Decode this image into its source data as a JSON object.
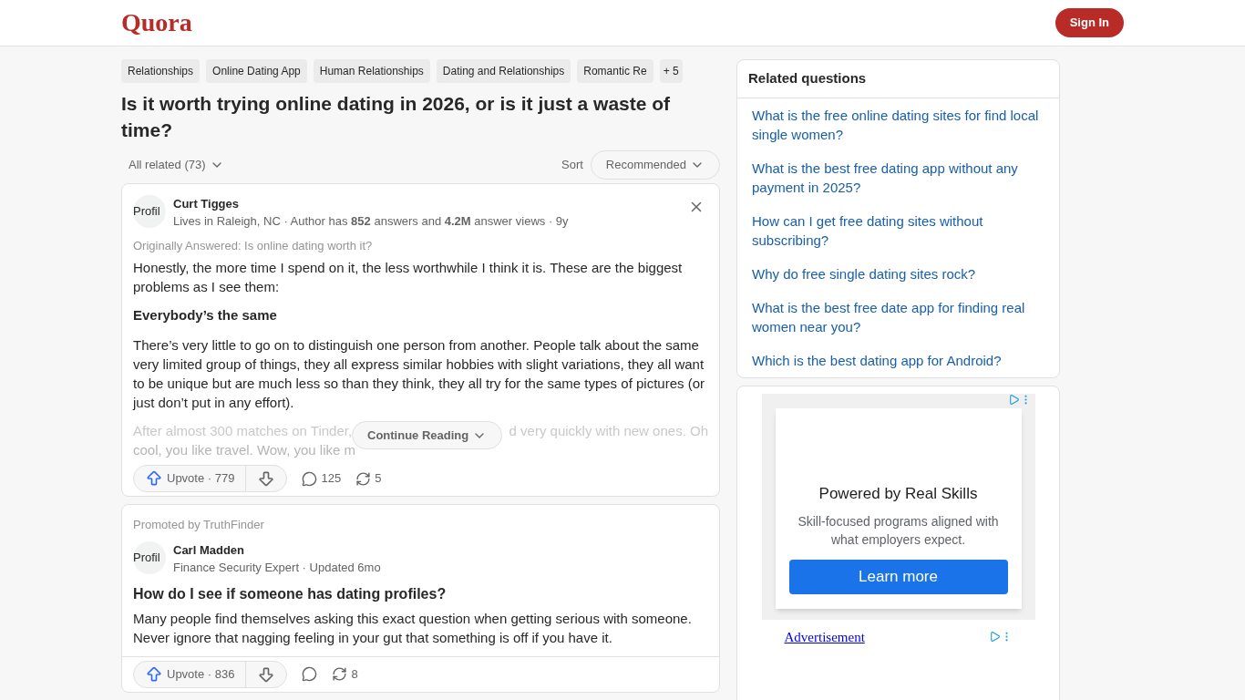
{
  "header": {
    "logo": "Quora",
    "sign_in": "Sign In"
  },
  "topics": [
    "Relationships",
    "Online Dating App",
    "Human Relationships",
    "Dating and Relationships",
    "Romantic Re"
  ],
  "topics_more": "+ 5",
  "question": "Is it worth trying online dating in 2026, or is it just a waste of time?",
  "filter": {
    "label": "All related (73)",
    "sort_label": "Sort",
    "sort_value": "Recommended"
  },
  "answers": [
    {
      "kind": "answer",
      "avatar_alt": "Profil",
      "author": "Curt Tigges",
      "meta": "Lives in Raleigh, NC · Author has **852** answers and **4.2M** answer views · 9y",
      "original": "Originally Answered: Is online dating worth it?",
      "paragraphs": [
        {
          "kind": "text",
          "text": "Honestly, the more time I spend on it, the less worthwhile I think it is. These are the biggest problems as I see them:"
        },
        {
          "kind": "heading",
          "text": "Everybody’s the same"
        },
        {
          "kind": "text",
          "text": "There’s very little to go on to distinguish one person from another. People talk about the same very limited group of things, they all express similar hobbies with slight variations, they all want to be unique but are much less so than they think, they all try for the same types of pictures (or just don’t put in any effort)."
        }
      ],
      "fade": {
        "left": "After almost 300 matches on Tinder,",
        "right": "d very quickly with new ones. Oh",
        "line2": "cool, you like travel. Wow, you like m"
      },
      "continue": "Continue Reading",
      "upvote": "Upvote · 779",
      "comments": "125",
      "shares": "5"
    },
    {
      "kind": "promoted",
      "promoted": "Promoted by TruthFinder",
      "avatar_alt": "Profil",
      "author": "Carl Madden",
      "meta": "Finance Security Expert · Updated 6mo",
      "title": "How do I see if someone has dating profiles?",
      "paragraphs": [
        {
          "kind": "text",
          "text": "Many people find themselves asking this exact question when getting serious with someone. Never ignore that nagging feeling in your gut that something is off if you have it."
        }
      ],
      "upvote": "Upvote · 836",
      "shares": "8"
    }
  ],
  "related": {
    "title": "Related questions",
    "items": [
      "What is the free online dating sites for find local single women?",
      "What is the best free dating app without any payment in 2025?",
      "How can I get free dating sites without subscribing?",
      "Why do free single dating sites rock?",
      "What is the best free date app for finding real women near you?",
      "Which is the best dating app for Android?"
    ]
  },
  "ad": {
    "headline": "Powered by Real Skills",
    "body": "Skill-focused programs aligned with what employers expect.",
    "cta": "Learn more",
    "alt": "Advertisement"
  }
}
